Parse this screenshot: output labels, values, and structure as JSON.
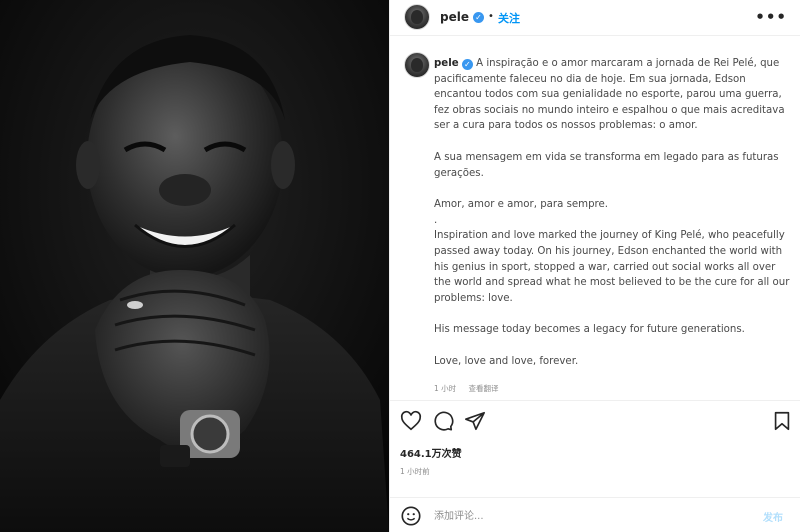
{
  "post": {
    "username": "pele",
    "separator": "•",
    "follow_label": "关注",
    "more_label": "•••",
    "caption_pt_1": "A inspiração e o amor marcaram a jornada de Rei Pelé, que pacificamente faleceu no dia de hoje. Em sua jornada, Edson encantou todos com sua genialidade no esporte, parou uma guerra, fez obras sociais no mundo inteiro e espalhou o que mais acreditava ser a cura para todos os nossos problemas: o amor.",
    "caption_pt_2": "A sua mensagem em vida se transforma em legado para as futuras gerações.",
    "caption_pt_3": "Amor, amor e amor, para sempre.",
    "caption_dot": ".",
    "caption_en_1": "Inspiration and love marked the journey of King Pelé, who peacefully passed away today. On his journey, Edson enchanted the world with his genius in sport, stopped a war, carried out social works all over the world and spread what he most believed to be the cure for all our problems: love.",
    "caption_en_2": "His message today becomes a legacy for future generations.",
    "caption_en_3": "Love, love and love, forever.",
    "caption_time": "1 小时",
    "translate_label": "查看翻译",
    "likes": "464.1万次赞",
    "post_time": "1 小时前",
    "comment_placeholder": "添加评论...",
    "post_label": "发布"
  },
  "icons": {
    "like": "heart-icon",
    "comment": "comment-icon",
    "share": "send-icon",
    "save": "bookmark-icon",
    "emoji": "emoji-icon",
    "verified": "verified-badge-icon"
  },
  "colors": {
    "accent": "#0095f6",
    "verified": "#3897f0",
    "muted": "#8e8e8e"
  }
}
